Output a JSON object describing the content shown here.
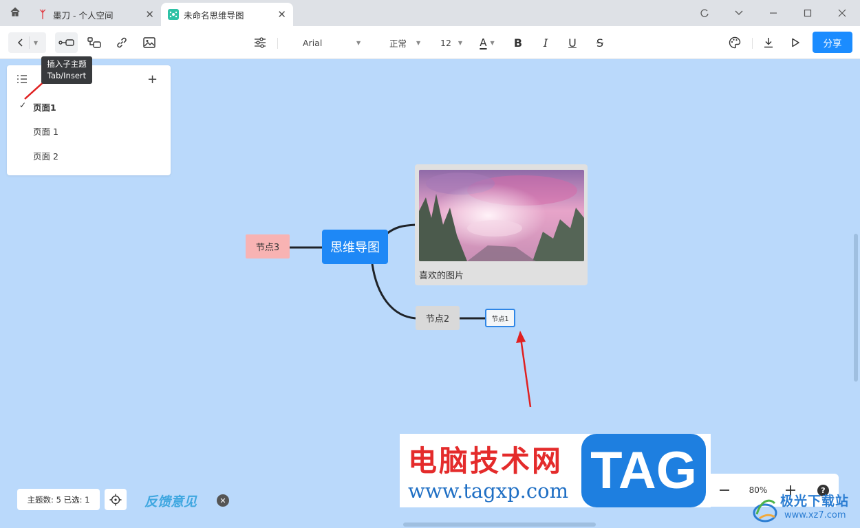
{
  "tabs": [
    {
      "title": "墨刀 - 个人空间",
      "logo": "M"
    },
    {
      "title": "未命名思维导图",
      "logo": "M"
    }
  ],
  "window_controls": {
    "refresh": "C",
    "dropdown": "∨",
    "minimize": "—",
    "maximize": "☐",
    "close": "✕"
  },
  "toolbar": {
    "font_family": "Arial",
    "font_style": "正常",
    "font_size": "12",
    "text_color_letter": "A",
    "bold": "B",
    "italic": "I",
    "underline": "U",
    "strikethrough": "S",
    "share_label": "分享",
    "accent": "#1b8cff"
  },
  "tooltip": {
    "title": "插入子主题",
    "shortcut": "Tab/Insert"
  },
  "pages_panel": {
    "current": "页面1",
    "items": [
      "页面 1",
      "页面 2"
    ]
  },
  "mindmap": {
    "root": "思维导图",
    "node3": "节点3",
    "node2": "节点2",
    "node1": "节点1",
    "image_caption": "喜欢的图片",
    "colors": {
      "root": "#1e88f6",
      "node3": "#f8b3b3",
      "node2": "#d9d9d9",
      "canvas": "#bad9fb"
    }
  },
  "status": {
    "text": "主题数: 5 已选: 1"
  },
  "feedback": {
    "label": "反馈意见"
  },
  "zoom": {
    "value": "80%",
    "help": "?"
  },
  "watermark": {
    "cn_title": "电脑技术网",
    "url": "www.tagxp.com",
    "tag": "TAG",
    "site2_title": "极光下载站",
    "site2_url": "www.xz7.com"
  }
}
